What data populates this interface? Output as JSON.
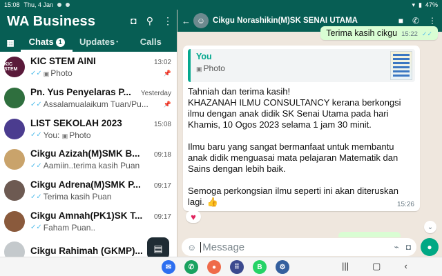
{
  "status": {
    "time": "15:08",
    "date": "Thu, 4 Jan",
    "battery": "47%"
  },
  "left": {
    "app_title": "WA Business",
    "tabs": {
      "chats": "Chats",
      "chats_badge": "1",
      "updates": "Updates",
      "updates_dot": "•",
      "calls": "Calls"
    },
    "chats": [
      {
        "name": "KIC STEM AINI",
        "time": "13:02",
        "preview": "Photo",
        "avatar_label": "KIC STEM",
        "avatar_color": "#5a1a3a"
      },
      {
        "name": "Pn. Yus Penyelaras P...",
        "time": "Yesterday",
        "preview": "Assalamualaikum Tuan/Pu...",
        "avatar_label": "",
        "avatar_color": "#2f6f3e"
      },
      {
        "name": "LIST SEKOLAH 2023",
        "time": "15:08",
        "preview": "You: Photo",
        "avatar_label": "",
        "avatar_color": "#4b3c8f"
      },
      {
        "name": "Cikgu Azizah(M)SMK B...",
        "time": "09:18",
        "preview": "Aamiin..terima kasih Puan",
        "avatar_label": "",
        "avatar_color": "#c9a36b"
      },
      {
        "name": "Cikgu Adrena(M)SMK P...",
        "time": "09:17",
        "preview": "Terima kasih Puan",
        "avatar_label": "",
        "avatar_color": "#6d5a52"
      },
      {
        "name": "Cikgu Amnah(PK1)SK T...",
        "time": "09:17",
        "preview": "Faham Puan..",
        "avatar_label": "",
        "avatar_color": "#8a5a3c"
      },
      {
        "name": "Cikgu Rahimah (GKMP)...",
        "time": "",
        "preview": "",
        "avatar_label": "",
        "avatar_color": "#c4c9cc"
      }
    ]
  },
  "right": {
    "contact_name": "Cikgu Norashikin(M)SK SENAI UTAMA",
    "outgoing_top": {
      "text": "Terima kasih cikgu",
      "time": "15:22"
    },
    "incoming": {
      "quote_author": "You",
      "quote_text": "Photo",
      "paragraphs": [
        "Tahniah dan terima kasih!\nKHAZANAH ILMU CONSULTANCY kerana berkongsi ilmu dengan anak didik SK Senai Utama pada hari Khamis, 10 Ogos 2023 selama 1 jam 30 minit.",
        "Ilmu baru yang sangat bermanfaat untuk membantu anak didik menguasai mata pelajaran Matematik dan Sains dengan lebih baik.",
        "Semoga perkongsian ilmu seperti ini akan diteruskan lagi. 👍"
      ],
      "time": "15:26",
      "reaction": "♥"
    },
    "composer": {
      "placeholder": "Message"
    }
  },
  "colors": {
    "brand": "#075e54",
    "accent": "#00a884",
    "out_bubble": "#d9fdd3",
    "chat_bg": "#efe7de"
  }
}
